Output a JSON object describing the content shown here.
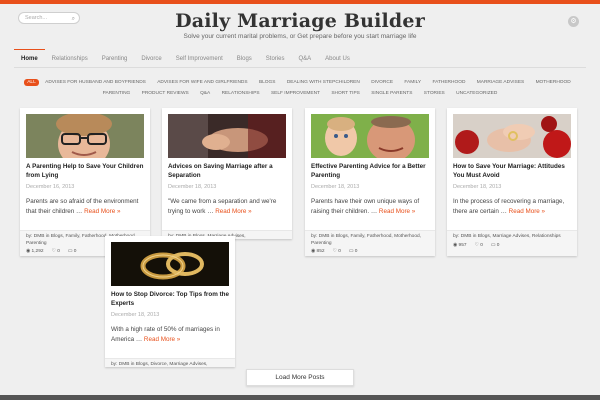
{
  "header": {
    "search_placeholder": "Search...",
    "site_title": "Daily Marriage Builder",
    "tagline": "Solve your current marital problems, or Get prepare before you start marriage life"
  },
  "nav": {
    "items": [
      "Home",
      "Relationships",
      "Parenting",
      "Divorce",
      "Self Improvement",
      "Blogs",
      "Stories",
      "Q&A",
      "About Us"
    ],
    "active": "Home"
  },
  "categories": [
    "ALL",
    "ADVISES FOR HUSBAND AND BOYFRIENDS",
    "ADVISES FOR WIFE AND GIRLFRIENDS",
    "BLOGS",
    "DEALING WITH STEPCHILDREN",
    "DIVORCE",
    "FAMILY",
    "FATHERHOOD",
    "MARRIAGE ADVISES",
    "MOTHERHOOD",
    "PARENTING",
    "PRODUCT REVIEWS",
    "Q&A",
    "RELATIONSHIPS",
    "SELF IMPROVEMENT",
    "SHORT TIPS",
    "SINGLE PARENTS",
    "STORIES",
    "UNCATEGORIZED"
  ],
  "posts": [
    {
      "title": "A Parenting Help to Save Your Children from Lying",
      "date": "December 16, 2013",
      "excerpt": "Parents are so afraid of the environment that their children …",
      "more": "Read More »",
      "meta": "by: DMB in Blogs, Family, Fatherhood, Motherhood, Parenting",
      "views": "1,292",
      "likes": "0",
      "comments": "0"
    },
    {
      "title": "Advices on Saving Marriage after a Separation",
      "date": "December 18, 2013",
      "excerpt": "\"We came from a separation and we're trying to work …",
      "more": "Read More »",
      "meta": "by: DMB in Blogs, Marriage Advises,",
      "views": "",
      "likes": "",
      "comments": ""
    },
    {
      "title": "Effective Parenting Advice for a Better Parenting",
      "date": "December 18, 2013",
      "excerpt": "Parents have their own unique ways of raising their children. …",
      "more": "Read More »",
      "meta": "by: DMB in Blogs, Family, Fatherhood, Motherhood, Parenting",
      "views": "852",
      "likes": "0",
      "comments": "0"
    },
    {
      "title": "How to Save Your Marriage: Attitudes You Must Avoid",
      "date": "December 18, 2013",
      "excerpt": "In the process of recovering a marriage, there are certain …",
      "more": "Read More »",
      "meta": "by: DMB in Blogs, Marriage Advises, Relationships",
      "views": "957",
      "likes": "0",
      "comments": "0"
    },
    {
      "title": "How to Stop Divorce: Top Tips from the Experts",
      "date": "December 18, 2013",
      "excerpt": "With a high rate of 50% of marriages in America …",
      "more": "Read More »",
      "meta": "by: DMB in Blogs, Divorce, Marriage Advises,",
      "views": "",
      "likes": "",
      "comments": ""
    }
  ],
  "load_more": "Load More Posts",
  "colors": {
    "accent": "#e8501b",
    "link": "#e8501b"
  }
}
